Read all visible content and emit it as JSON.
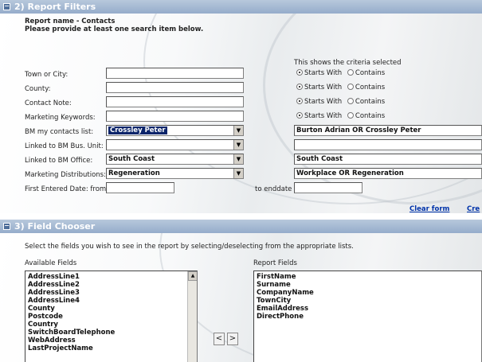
{
  "section2": {
    "toggle": "−",
    "title": "2) Report Filters",
    "report_name": "Report name - Contacts",
    "instruction": "Please provide at least one search item below.",
    "criteria_header": "This shows the criteria selected",
    "radio_starts": "Starts With",
    "radio_contains": "Contains",
    "labels": {
      "town": "Town or City:",
      "county": "County:",
      "note": "Contact Note:",
      "keywords": "Marketing Keywords:",
      "bm_list": "BM my contacts list:",
      "bus_unit": "Linked to BM Bus. Unit:",
      "office": "Linked to BM Office:",
      "distributions": "Marketing Distributions:",
      "first_entered": "First Entered Date: from",
      "to_enddate": "to enddate"
    },
    "values": {
      "town": "",
      "county": "",
      "note": "",
      "keywords": "",
      "bm_list": "Crossley Peter",
      "bus_unit": "",
      "office": "South Coast",
      "distributions": "Regeneration",
      "date_from": "",
      "date_to": ""
    },
    "criteria": {
      "bm_list": "Burton Adrian OR Crossley Peter",
      "bus_unit": "",
      "office": "South Coast",
      "distributions": "Workplace OR Regeneration"
    },
    "clear_form": "Clear form",
    "create": "Cre"
  },
  "section3": {
    "toggle": "−",
    "title": "3) Field Chooser",
    "instruction": "Select the fields you wish to see in the report by selecting/deselecting from the appropriate lists.",
    "available_label": "Available Fields",
    "report_label": "Report Fields",
    "available_fields": [
      "AddressLine1",
      "AddressLine2",
      "AddressLine3",
      "AddressLine4",
      "County",
      "Postcode",
      "Country",
      "SwitchBoardTelephone",
      "WebAddress",
      "LastProjectName"
    ],
    "report_fields": [
      "FirstName",
      "Surname",
      "CompanyName",
      "TownCity",
      "EmailAddress",
      "DirectPhone"
    ],
    "move_left": "<",
    "move_right": ">"
  }
}
